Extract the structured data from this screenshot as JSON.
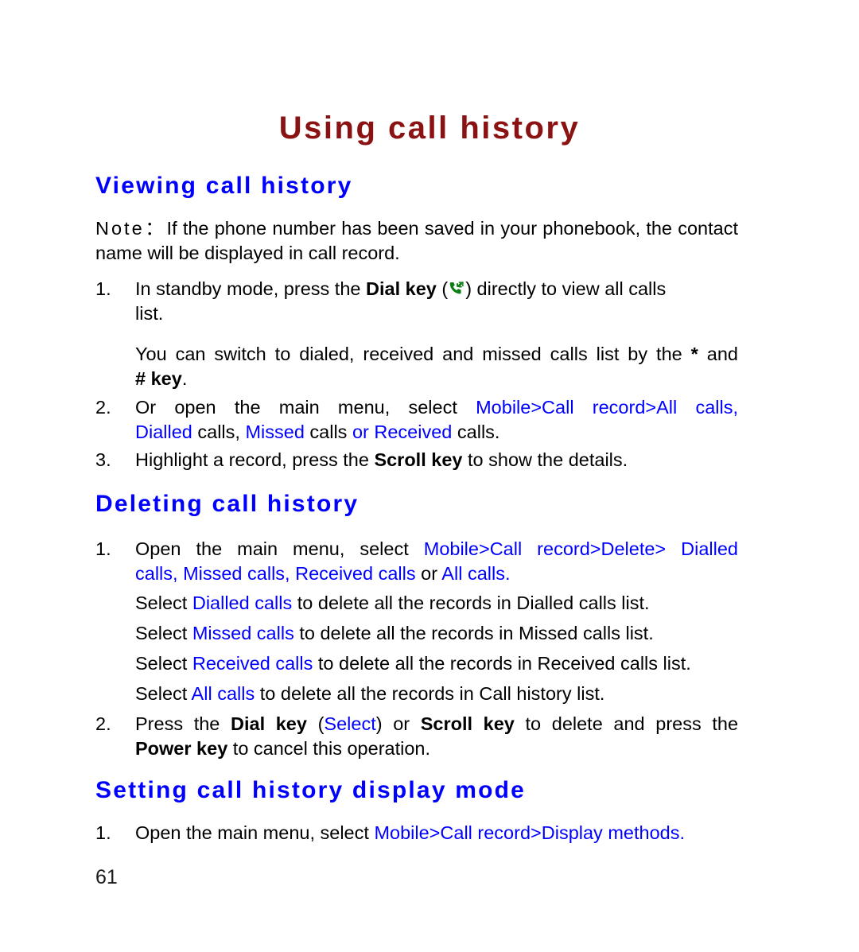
{
  "document": {
    "title": "Using call history",
    "page_number": "61",
    "title_color": "#8B1212",
    "heading_color": "#0000FF",
    "link_color": "#0000FF",
    "body_color": "#000000"
  },
  "sections": [
    {
      "heading": "Viewing call history",
      "note": {
        "label": "Note：",
        "text": "If the phone number has been saved in your phonebook, the contact name will be displayed in call record."
      },
      "items": [
        {
          "number": "1.",
          "line1_a": "In standby mode, press the ",
          "line1_bold": "Dial key",
          "line1_b": " (",
          "icon": "dial-key-icon",
          "line1_c": ") directly to view all calls",
          "line2": "list."
        },
        {
          "number": "",
          "para_a": "You can switch to dialed, received and missed calls list by the ",
          "para_bold1": "*",
          "para_b": " and",
          "para_bold2": "# key",
          "para_c": "."
        },
        {
          "number": "2.",
          "line1_a": "Or open the main menu, select ",
          "line1_blue": "Mobile>Call record>All calls,",
          "line2_blue1": "Dialled",
          "line2_a": " calls, ",
          "line2_blue2": "Missed",
          "line2_b": " calls ",
          "line2_blue3": "or Received",
          "line2_c": " calls."
        },
        {
          "number": "3.",
          "line1_a": "Highlight a record, press the ",
          "line1_bold": "Scroll key",
          "line1_b": " to show the details."
        }
      ]
    },
    {
      "heading": "Deleting call history",
      "items": [
        {
          "number": "1.",
          "line1_a": "Open the main menu, select ",
          "line1_blue": "Mobile>Call record>Delete> Dialled",
          "line2_blue1": "calls, Missed calls, Received calls",
          "line2_a": " or ",
          "line2_blue2": "All calls."
        }
      ],
      "select_lines": [
        {
          "a": "Select ",
          "blue": "Dialled calls",
          "b": " to delete all the records in Dialled calls list."
        },
        {
          "a": "Select ",
          "blue": "Missed calls",
          "b": " to delete all the records in Missed calls list."
        },
        {
          "a": "Select ",
          "blue": "Received calls",
          "b": " to delete all the records in Received calls list."
        },
        {
          "a": "Select ",
          "blue": "All calls",
          "b": " to delete all the records in Call history list."
        }
      ],
      "item2": {
        "number": "2.",
        "line1_a": "Press the ",
        "line1_bold1": "Dial key",
        "line1_b": " (",
        "line1_blue": "Select",
        "line1_c": ") or ",
        "line1_bold2": "Scroll key",
        "line1_d": " to delete and press the",
        "line2_bold": "Power key",
        "line2_a": " to cancel this operation."
      }
    },
    {
      "heading": "Setting call history display mode",
      "items": [
        {
          "number": "1.",
          "line1_a": "Open the main menu, select ",
          "line1_blue": "Mobile>Call record>Display methods."
        }
      ]
    }
  ]
}
